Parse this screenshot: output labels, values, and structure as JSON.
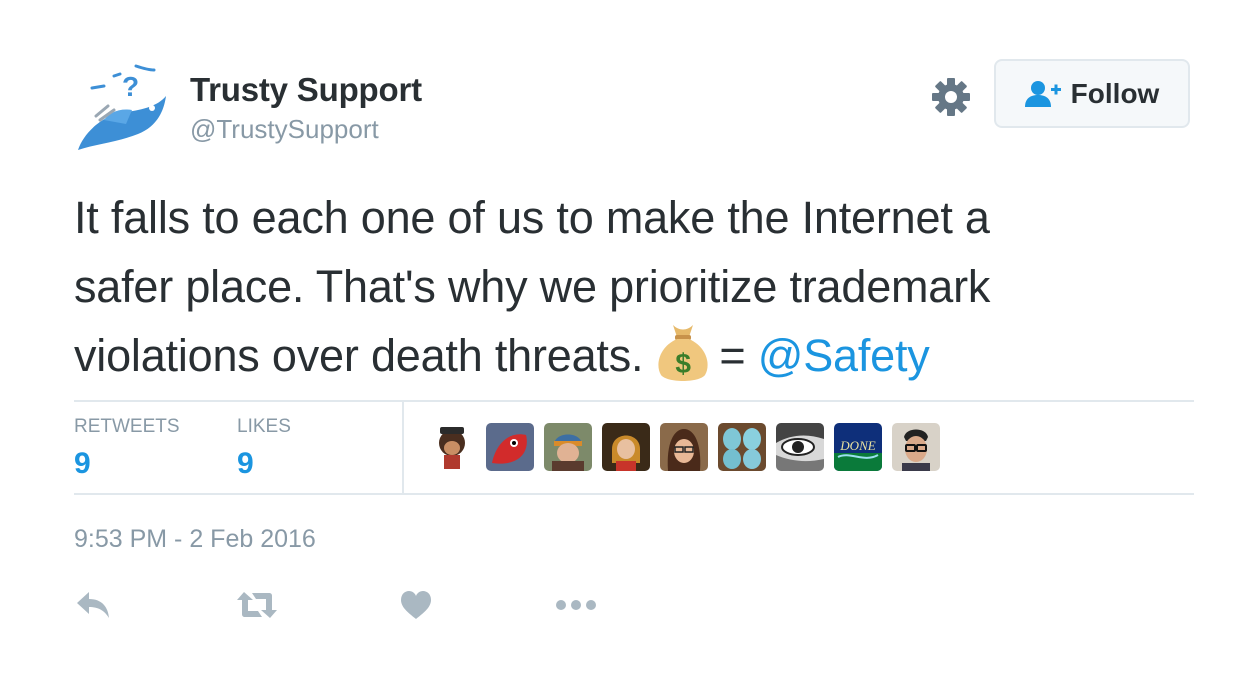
{
  "author": {
    "name": "Trusty Support",
    "handle": "@TrustySupport",
    "avatar_icon": "blue-bird-with-question-mark-icon"
  },
  "follow_button": {
    "label": "Follow",
    "icon": "add-user-icon"
  },
  "settings_icon": "gear-icon",
  "tweet": {
    "lines": [
      "It falls to each one of us to make the Internet a",
      "safer place. That's why we prioritize trademark",
      "violations over death threats."
    ],
    "emoji_icon": "money-bag-emoji",
    "equals": "=",
    "mention": "@Safety"
  },
  "stats": {
    "retweets_label": "RETWEETS",
    "retweets_count": "9",
    "likes_label": "LIKES",
    "likes_count": "9"
  },
  "likers": [
    "monkey-avatar",
    "red-devil-avatar",
    "beanie-person-avatar",
    "costume-person-avatar",
    "glasses-woman-avatar",
    "blue-eggs-avatar",
    "eye-avatar",
    "done-logo-avatar",
    "man-glasses-avatar"
  ],
  "timestamp": "9:53 PM - 2 Feb 2016",
  "actions": [
    "reply-icon",
    "retweet-icon",
    "like-icon",
    "more-icon"
  ],
  "colors": {
    "link": "#1b95e0",
    "muted": "#8899a6",
    "text": "#292f33",
    "border": "#e1e8ed"
  }
}
